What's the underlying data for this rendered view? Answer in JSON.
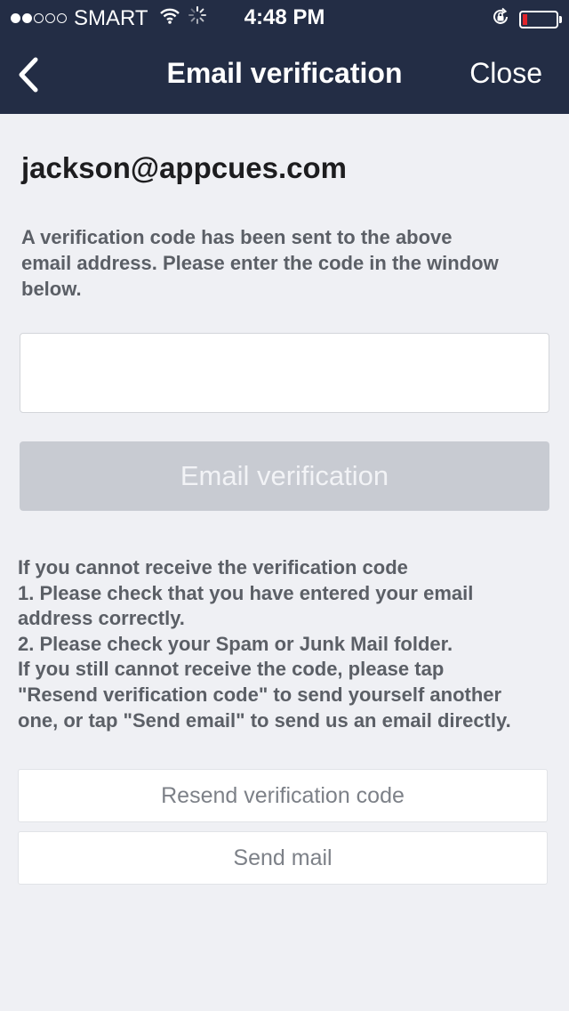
{
  "status_bar": {
    "carrier": "SMART",
    "time": "4:48 PM"
  },
  "nav": {
    "title": "Email verification",
    "close_label": "Close"
  },
  "email": "jackson@appcues.com",
  "instruction_lines": [
    "A verification code has been sent to the above",
    "email address. Please enter the code in the window",
    "below."
  ],
  "code_input": {
    "value": "",
    "placeholder": ""
  },
  "verify_button_label": "Email verification",
  "help_lines": [
    "If you cannot receive the verification code",
    "1. Please check that you have entered your email",
    "address correctly.",
    "2. Please check your Spam or Junk Mail folder.",
    "If you still cannot receive the code, please tap",
    "\"Resend verification code\" to send yourself another",
    "one, or tap \"Send email\" to send us an email directly."
  ],
  "resend_button_label": "Resend verification code",
  "send_mail_button_label": "Send mail",
  "colors": {
    "header_background": "#232d45",
    "page_background": "#eff0f4",
    "disabled_button": "#c8cbd2",
    "battery_low": "#e0232a"
  }
}
